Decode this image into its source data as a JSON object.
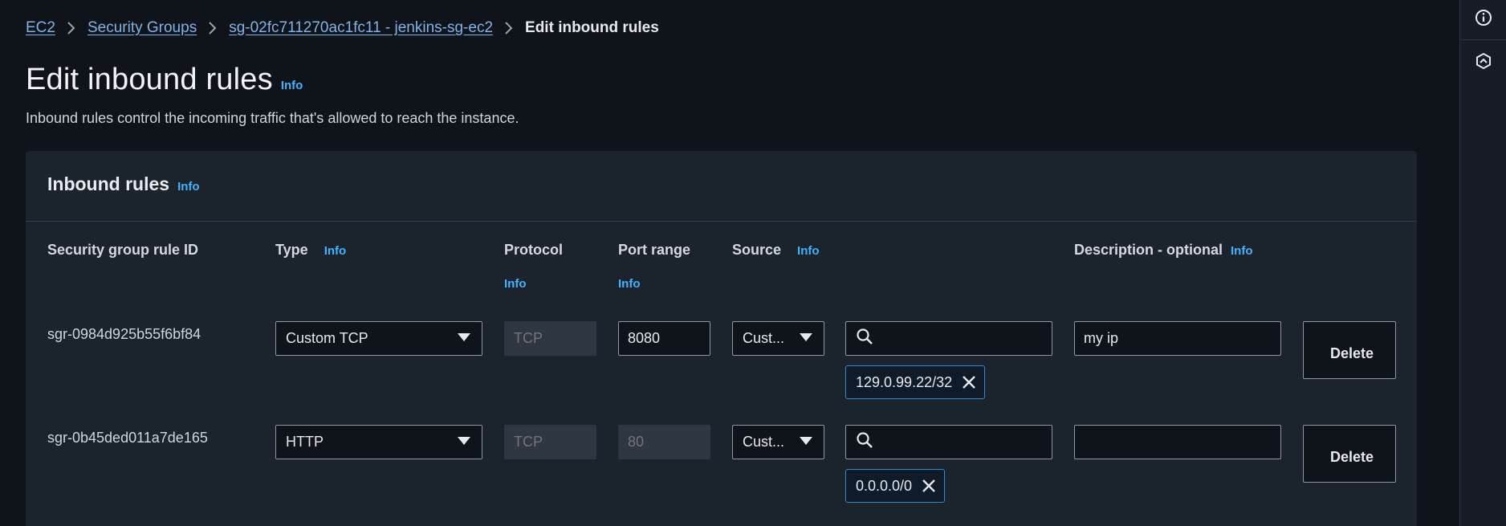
{
  "breadcrumb": {
    "items": [
      "EC2",
      "Security Groups",
      "sg-02fc711270ac1fc11 - jenkins-sg-ec2"
    ],
    "current": "Edit inbound rules"
  },
  "page": {
    "title": "Edit inbound rules",
    "title_info": "Info",
    "description": "Inbound rules control the incoming traffic that's allowed to reach the instance."
  },
  "panel": {
    "title": "Inbound rules",
    "title_info": "Info"
  },
  "columns": {
    "rule_id": "Security group rule ID",
    "type": "Type",
    "type_info": "Info",
    "protocol": "Protocol",
    "protocol_info": "Info",
    "port_range": "Port range",
    "port_range_info": "Info",
    "source": "Source",
    "source_info": "Info",
    "description": "Description - optional",
    "description_info": "Info"
  },
  "rules": [
    {
      "rule_id": "sgr-0984d925b55f6bf84",
      "type": "Custom TCP",
      "protocol": "TCP",
      "port_range": "8080",
      "port_range_disabled": false,
      "source": "Cust...",
      "search_value": "",
      "token": "129.0.99.22/32",
      "description": "my ip",
      "delete_label": "Delete"
    },
    {
      "rule_id": "sgr-0b45ded011a7de165",
      "type": "HTTP",
      "protocol": "TCP",
      "port_range": "80",
      "port_range_disabled": true,
      "source": "Cust...",
      "search_value": "",
      "token": "0.0.0.0/0",
      "description": "",
      "delete_label": "Delete"
    }
  ],
  "icons": {
    "rail_top": "info-circle-icon",
    "rail_second": "feedback-hexagon-icon",
    "breadcrumb_sep": "chevron-right-icon",
    "search": "search-icon",
    "token_remove": "close-icon",
    "select_caret": "caret-down-icon"
  },
  "colors": {
    "background": "#0f141a",
    "panel": "#1b232d",
    "link": "#7fb3ea",
    "info": "#42b4ff",
    "token_border": "#2f8fd6"
  }
}
